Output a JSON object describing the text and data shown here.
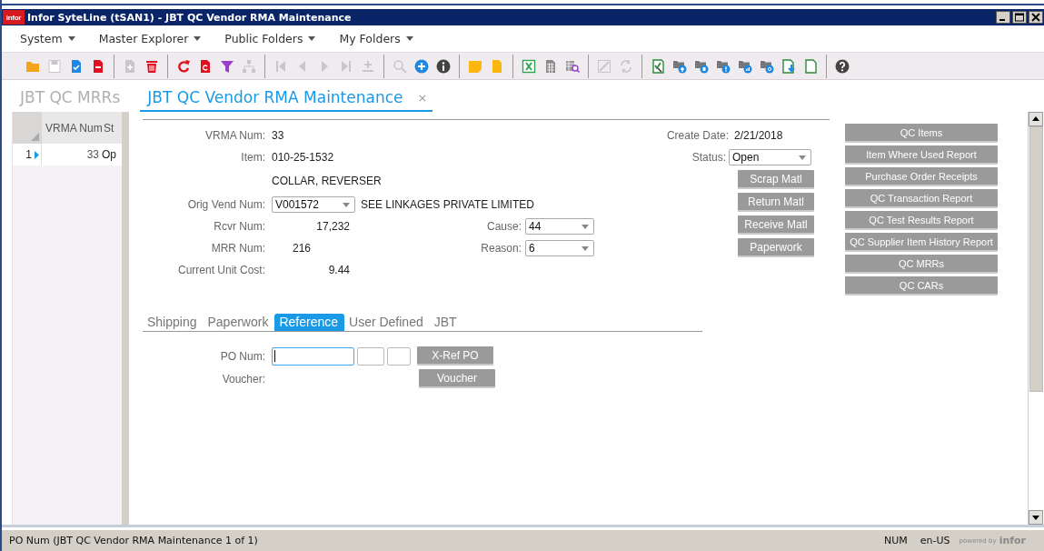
{
  "window": {
    "title": "Infor SyteLine (tSAN1) - JBT QC Vendor RMA Maintenance",
    "logo": "infor"
  },
  "menu": [
    {
      "label": "System"
    },
    {
      "label": "Master Explorer"
    },
    {
      "label": "Public Folders"
    },
    {
      "label": "My Folders"
    }
  ],
  "toolbar": [
    [
      {
        "kind": "folder",
        "disabled": false
      },
      {
        "kind": "save",
        "disabled": true
      },
      {
        "kind": "doc-check",
        "disabled": false
      },
      {
        "kind": "doc-minus",
        "disabled": false
      }
    ],
    [
      {
        "kind": "doc-plus",
        "disabled": true
      },
      {
        "kind": "trash",
        "disabled": false
      }
    ],
    [
      {
        "kind": "refresh",
        "disabled": false
      },
      {
        "kind": "doc-refresh",
        "disabled": false
      },
      {
        "kind": "filter",
        "disabled": false
      },
      {
        "kind": "tree",
        "disabled": true
      }
    ],
    [
      {
        "kind": "first",
        "disabled": true
      },
      {
        "kind": "prev",
        "disabled": true
      },
      {
        "kind": "next",
        "disabled": true
      },
      {
        "kind": "last",
        "disabled": true
      },
      {
        "kind": "add-row",
        "disabled": true
      }
    ],
    [
      {
        "kind": "search",
        "disabled": true
      },
      {
        "kind": "plus-circle",
        "disabled": false
      },
      {
        "kind": "info",
        "disabled": false
      }
    ],
    [
      {
        "kind": "note",
        "disabled": false
      },
      {
        "kind": "doc-yellow",
        "disabled": false
      }
    ],
    [
      {
        "kind": "sheet",
        "disabled": false
      },
      {
        "kind": "table",
        "disabled": false
      },
      {
        "kind": "table-search",
        "disabled": false
      }
    ],
    [
      {
        "kind": "sign",
        "disabled": true
      },
      {
        "kind": "sync",
        "disabled": true
      }
    ],
    [
      {
        "kind": "checklist",
        "disabled": false
      },
      {
        "kind": "folder-badge",
        "disabled": false
      },
      {
        "kind": "folder-badge",
        "disabled": false
      },
      {
        "kind": "folder-badge",
        "disabled": false
      },
      {
        "kind": "folder-badge",
        "disabled": false
      },
      {
        "kind": "folder-badge",
        "disabled": false
      },
      {
        "kind": "doc-down",
        "disabled": false
      },
      {
        "kind": "doc-green",
        "disabled": false
      }
    ],
    [
      {
        "kind": "help",
        "disabled": false
      }
    ]
  ],
  "tabs": [
    {
      "label": "JBT QC MRRs",
      "selected": false
    },
    {
      "label": "JBT QC Vendor RMA Maintenance",
      "selected": true,
      "close": "×"
    }
  ],
  "grid": {
    "columns": [
      "VRMA Num",
      "St"
    ],
    "rows": [
      {
        "row_number": "1",
        "selected": true,
        "cells": [
          "33",
          "Op"
        ]
      }
    ]
  },
  "form": {
    "fields": [
      {
        "kind": "text",
        "label": "VRMA Num:",
        "value": "33"
      },
      {
        "kind": "text",
        "label": "Item:",
        "value": "010-25-1532"
      },
      {
        "kind": "description",
        "value": "COLLAR, REVERSER"
      },
      {
        "kind": "combo",
        "label": "Orig Vend Num:",
        "value": "V001572",
        "extra": "SEE LINKAGES PRIVATE LIMITED"
      },
      {
        "kind": "number",
        "label": "Rcvr Num:",
        "value": "17,232",
        "side": {
          "label": "Cause:",
          "value": "44"
        }
      },
      {
        "kind": "short-number",
        "label": "MRR Num:",
        "value": "216",
        "side": {
          "label": "Reason:",
          "value": "6"
        }
      },
      {
        "kind": "number",
        "label": "Current Unit Cost:",
        "value": "9.44"
      }
    ],
    "create_date": {
      "label": "Create Date:",
      "value": "2/21/2018"
    },
    "status": {
      "label": "Status:",
      "value": "Open"
    },
    "action_buttons": [
      "Scrap Matl",
      "Return Matl",
      "Receive Matl",
      "Paperwork"
    ],
    "report_buttons": [
      "QC Items",
      "Item Where Used Report",
      "Purchase Order Receipts",
      "QC Transaction Report",
      "QC Test Results Report",
      "QC Supplier Item History Report",
      "QC MRRs",
      "QC CARs"
    ],
    "subtabs": [
      {
        "label": "Shipping",
        "selected": false
      },
      {
        "label": "Paperwork",
        "selected": false
      },
      {
        "label": "Reference",
        "selected": true
      },
      {
        "label": "User Defined",
        "selected": false
      },
      {
        "label": "JBT",
        "selected": false
      }
    ],
    "po_num": {
      "label": "PO Num:",
      "focused": true,
      "button": "X-Ref PO"
    },
    "voucher": {
      "label": "Voucher:",
      "button": "Voucher"
    }
  },
  "status_bar": {
    "message": "PO Num (JBT QC Vendor RMA Maintenance 1 of 1)",
    "num": "NUM",
    "locale": "en-US",
    "powered": "powered by",
    "brand": "infor"
  }
}
